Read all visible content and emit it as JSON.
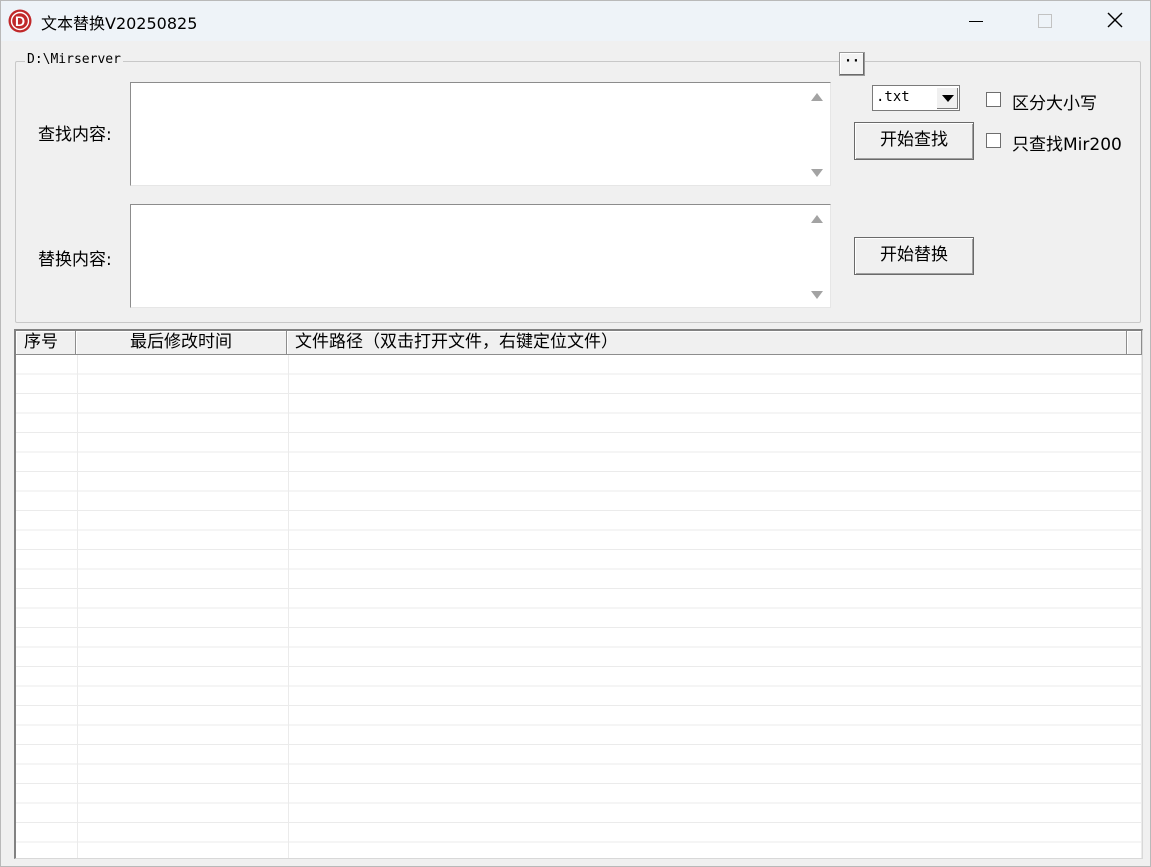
{
  "window": {
    "title": "文本替换V20250825",
    "logo_letter": "D",
    "accent_color": "#c0282a"
  },
  "group": {
    "path_label": "D:\\Mirserver",
    "browse_label": "··"
  },
  "find": {
    "label": "查找内容:",
    "value": ""
  },
  "replace": {
    "label": "替换内容:",
    "value": ""
  },
  "extension_select": {
    "selected": ".txt"
  },
  "buttons": {
    "start_find": "开始查找",
    "start_replace": "开始替换"
  },
  "options": {
    "case_sensitive": {
      "label": "区分大小写",
      "checked": false
    },
    "only_mir200": {
      "label": "只查找Mir200",
      "checked": false
    }
  },
  "results": {
    "columns": [
      "序号",
      "最后修改时间",
      "文件路径（双击打开文件，右键定位文件）"
    ],
    "rows": []
  },
  "icons": {
    "app": "app-logo-icon",
    "minimize": "minimize-icon",
    "maximize": "maximize-icon",
    "close": "close-icon",
    "scroll_up": "arrow-up-icon",
    "scroll_down": "arrow-down-icon",
    "dropdown": "caret-down-icon"
  }
}
